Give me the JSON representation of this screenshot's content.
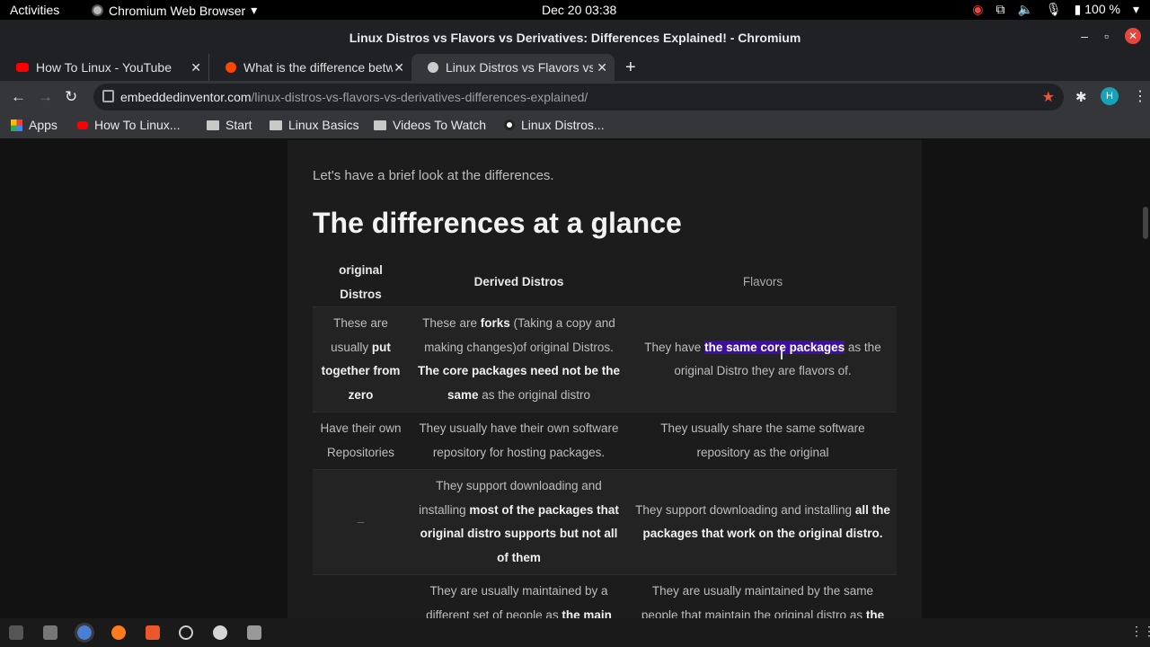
{
  "system_bar": {
    "activities": "Activities",
    "app_name": "Chromium Web Browser",
    "clock": "Dec 20  03:38",
    "battery": "100 %"
  },
  "window": {
    "title": "Linux Distros vs Flavors vs Derivatives: Differences Explained! - Chromium"
  },
  "tabs": [
    {
      "label": "How To Linux - YouTube"
    },
    {
      "label": "What is the difference betw"
    },
    {
      "label": "Linux Distros vs Flavors vs"
    }
  ],
  "address": {
    "domain": "embeddedinventor.com",
    "path": "/linux-distros-vs-flavors-vs-derivatives-differences-explained/"
  },
  "profile_initial": "H",
  "bookmarks": [
    {
      "label": "Apps"
    },
    {
      "label": "How To Linux..."
    },
    {
      "label": "Start"
    },
    {
      "label": "Linux Basics"
    },
    {
      "label": "Videos To Watch"
    },
    {
      "label": "Linux Distros..."
    }
  ],
  "article": {
    "intro": "Let's have a brief look at the differences.",
    "heading": "The differences at a glance",
    "columns": [
      "original Distros",
      "Derived Distros",
      "Flavors"
    ],
    "rows": [
      {
        "c1": [
          "These are usually ",
          "put together from zero"
        ],
        "c2": [
          "These are ",
          "forks",
          " (Taking a copy and making changes)of original Distros. ",
          "The core packages need not be the same",
          " as the original distro"
        ],
        "c3": [
          "They have ",
          "the same core packages",
          " as the original Distro they are flavors of."
        ]
      },
      {
        "c1": [
          "Have their own Repositories"
        ],
        "c2": [
          "They usually have their own software repository for hosting packages."
        ],
        "c3": [
          "They usually share the same software repository as the original"
        ]
      },
      {
        "c1": [
          "–"
        ],
        "c2": [
          "They support downloading and installing ",
          "most of the packages that original distro supports but not all of them"
        ],
        "c3": [
          "They support downloading and installing ",
          "all the packages that work on the original distro."
        ]
      },
      {
        "c1": [
          "–"
        ],
        "c2": [
          "They are usually maintained by a different set of people as ",
          "the main goal of the derivative differs from the"
        ],
        "c3": [
          "They are usually maintained by the same people that maintain the original distro as ",
          "the main goal of the flavor is usually the same as the"
        ]
      }
    ]
  }
}
